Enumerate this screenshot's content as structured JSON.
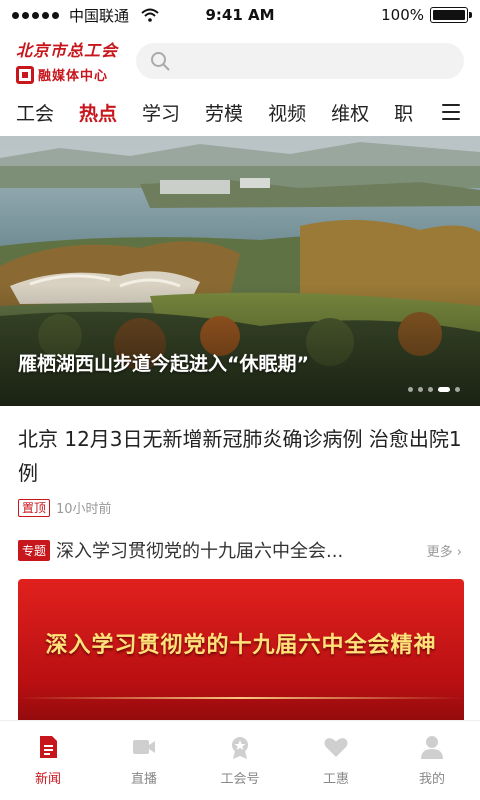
{
  "status_bar": {
    "carrier": "中国联通",
    "time": "9:41 AM",
    "battery": "100%"
  },
  "header": {
    "logo_top": "北京市总工会",
    "logo_bottom": "融媒体中心",
    "search_placeholder": ""
  },
  "tabs": [
    {
      "label": "工会"
    },
    {
      "label": "热点"
    },
    {
      "label": "学习"
    },
    {
      "label": "劳模"
    },
    {
      "label": "视频"
    },
    {
      "label": "维权"
    },
    {
      "label": "职"
    }
  ],
  "active_tab": "热点",
  "hero": {
    "caption": "雁栖湖西山步道今起进入“休眠期”",
    "slides": 5,
    "active_slide": 4
  },
  "news": {
    "title": "北京 12月3日无新增新冠肺炎确诊病例 治愈出院1例",
    "pin_label": "置顶",
    "time": "10小时前"
  },
  "topic": {
    "badge": "专题",
    "title": "深入学习贯彻党的十九届六中全会...",
    "more": "更多 ›",
    "banner_text": "深入学习贯彻党的十九届六中全会精神"
  },
  "bottom_nav": [
    {
      "label": "新闻",
      "icon": "news-icon",
      "active": true
    },
    {
      "label": "直播",
      "icon": "video-camera-icon",
      "active": false
    },
    {
      "label": "工会号",
      "icon": "badge-icon",
      "active": false
    },
    {
      "label": "工惠",
      "icon": "heart-icon",
      "active": false
    },
    {
      "label": "我的",
      "icon": "user-icon",
      "active": false
    }
  ],
  "colors": {
    "accent": "#c8161d",
    "inactive": "#888888"
  }
}
